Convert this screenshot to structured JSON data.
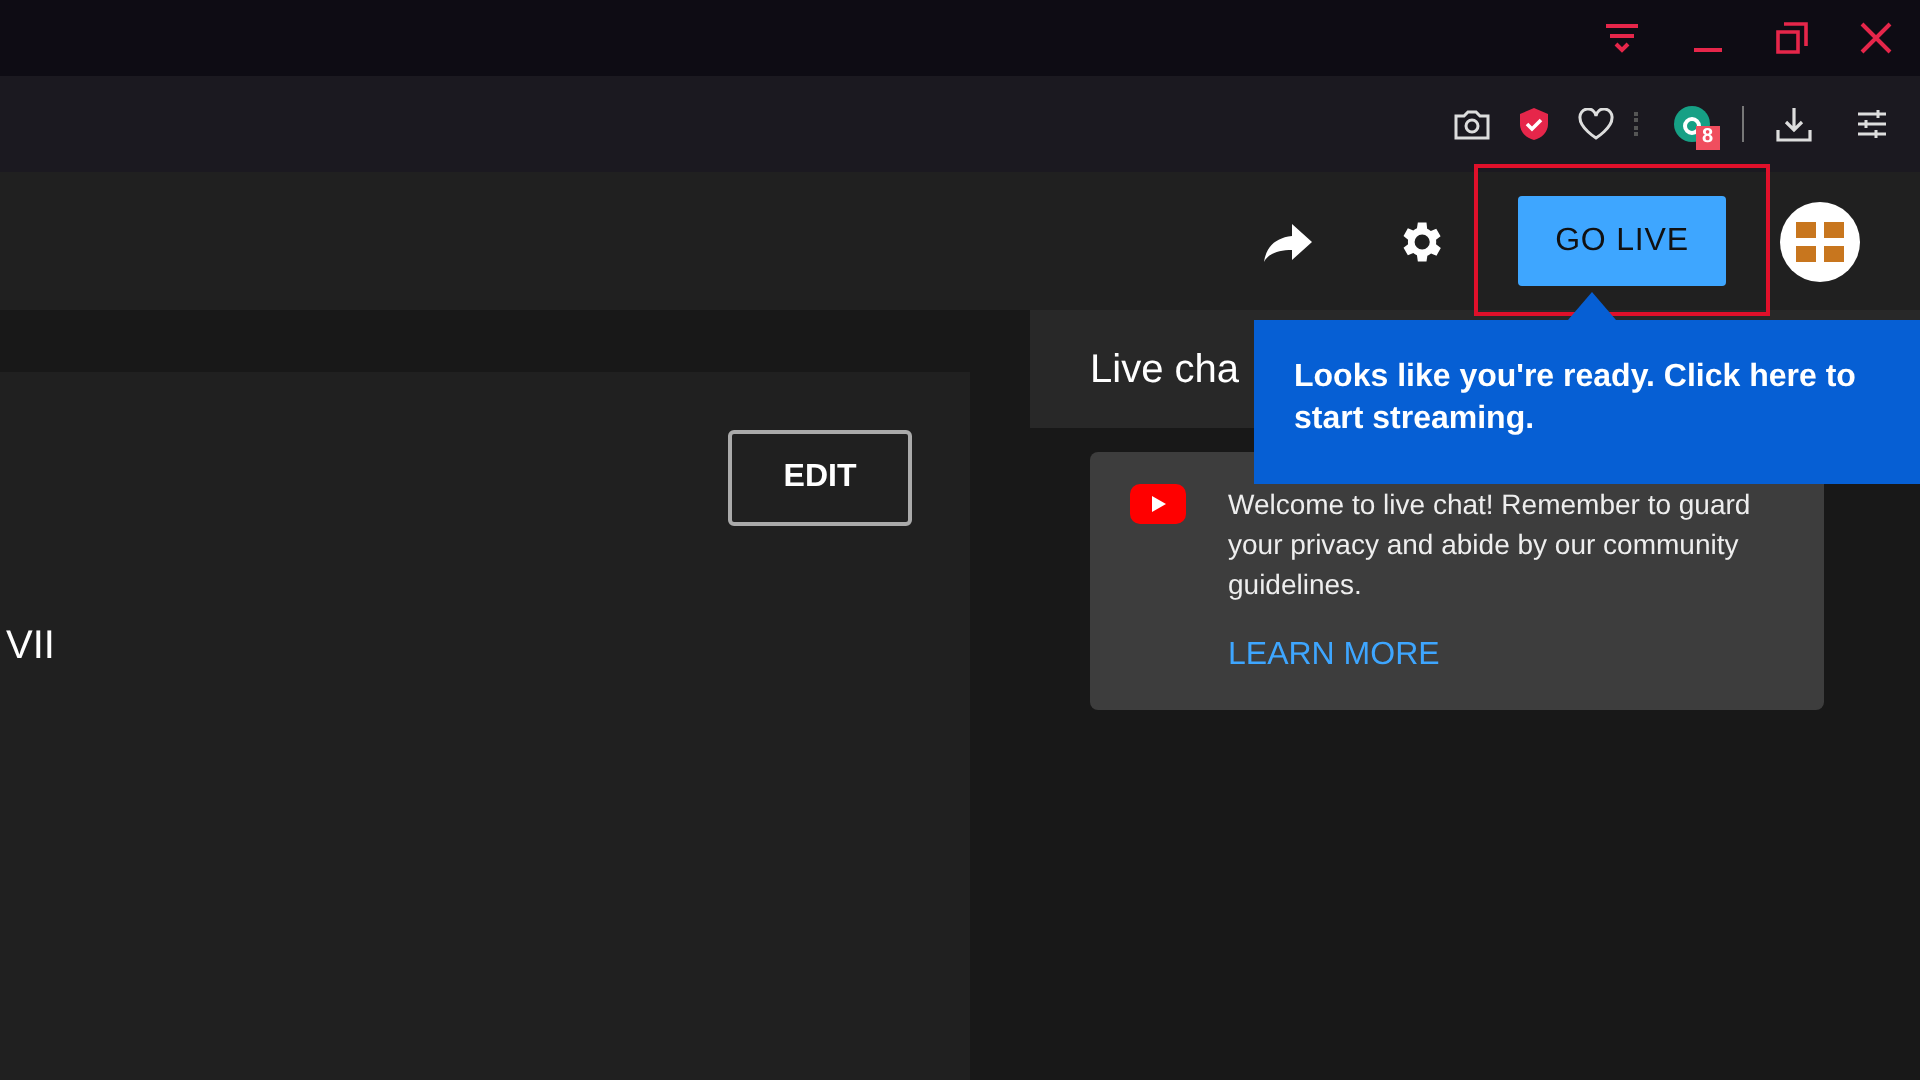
{
  "header": {
    "go_live_button": "GO LIVE",
    "highlighted": true
  },
  "toolbar": {
    "extension_badge": "8"
  },
  "tooltip": {
    "text": "Looks like you're ready. Click here to start streaming."
  },
  "details": {
    "edit_button": "EDIT",
    "title_fragment": "VII"
  },
  "live_chat": {
    "title": "Live cha",
    "welcome": "Welcome to live chat! Remember to guard your privacy and abide by our community guidelines.",
    "learn_more": "LEARN MORE"
  }
}
